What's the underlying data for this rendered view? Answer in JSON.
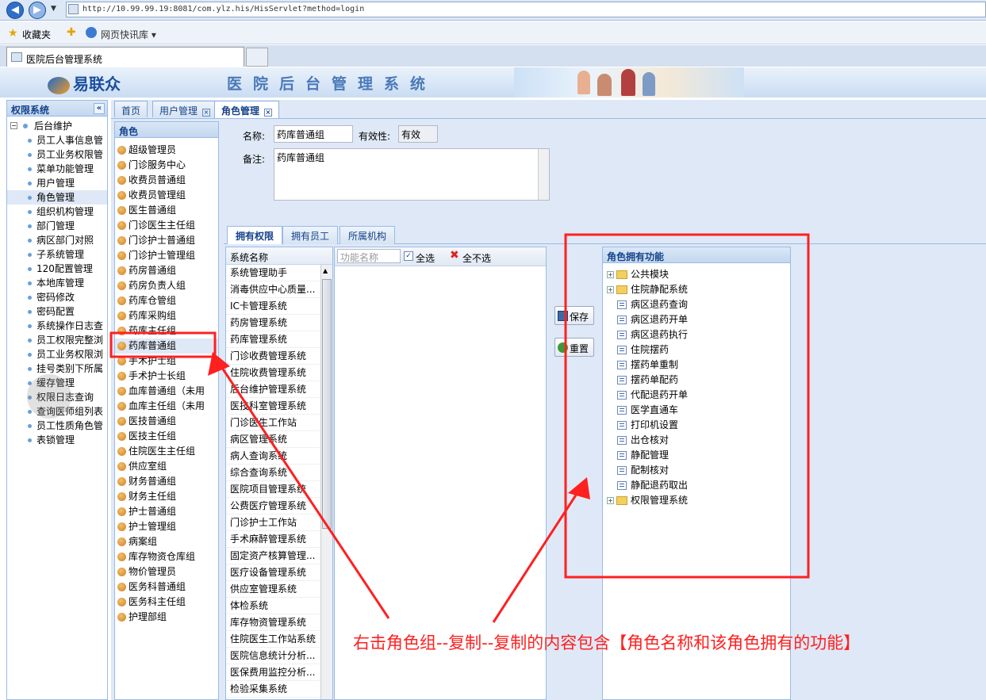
{
  "browser": {
    "url": "http://10.99.99.19:8081/com.ylz.his/HisServlet?method=login",
    "favorites_label": "收藏夹",
    "quick_link_label": "网页快讯库",
    "tab_title": "医院后台管理系统"
  },
  "header": {
    "logo_text": "易联众",
    "system_title": "医院后台管理系统"
  },
  "left_nav": {
    "title": "权限系统",
    "root": "后台维护",
    "items": [
      "员工人事信息管",
      "员工业务权限管",
      "菜单功能管理",
      "用户管理",
      "角色管理",
      "组织机构管理",
      "部门管理",
      "病区部门对照",
      "子系统管理",
      "120配置管理",
      "本地库管理",
      "密码修改",
      "密码配置",
      "系统操作日志查",
      "员工权限完整浏",
      "员工业务权限浏",
      "挂号类别下所属",
      "缓存管理",
      "权限日志查询",
      "查询医师组列表",
      "员工性质角色管",
      "表锁管理"
    ]
  },
  "tabs": [
    "首页",
    "用户管理",
    "角色管理"
  ],
  "role_panel": {
    "title": "角色",
    "roles": [
      "超级管理员",
      "门诊服务中心",
      "收费员普通组",
      "收费员管理组",
      "医生普通组",
      "门诊医生主任组",
      "门诊护士普通组",
      "门诊护士管理组",
      "药房普通组",
      "药房负责人组",
      "药库仓管组",
      "药库采购组",
      "药库主任组",
      "药库普通组",
      "手术护士组",
      "手术护士长组",
      "血库普通组（未用",
      "血库主任组（未用",
      "医技普通组",
      "医技主任组",
      "住院医生主任组",
      "供应室组",
      "财务普通组",
      "财务主任组",
      "护士普通组",
      "护士管理组",
      "病案组",
      "库存物资仓库组",
      "物价管理员",
      "医务科普通组",
      "医务科主任组",
      "护理部组"
    ]
  },
  "form": {
    "name_label": "名称:",
    "name_value": "药库普通组",
    "validity_label": "有效性:",
    "validity_value": "有效",
    "remark_label": "备注:",
    "remark_value": "药库普通组"
  },
  "sub_tabs": [
    "拥有权限",
    "拥有员工",
    "所属机构"
  ],
  "system_list": {
    "header": "系统名称",
    "items": [
      "系统管理助手",
      "消毒供应中心质量...",
      "IC卡管理系统",
      "药房管理系统",
      "药库管理系统",
      "门诊收费管理系统",
      "住院收费管理系统",
      "后台维护管理系统",
      "医技科室管理系统",
      "门诊医生工作站",
      "病区管理系统",
      "病人查询系统",
      "综合查询系统",
      "医院项目管理系统",
      "公费医疗管理系统",
      "门诊护士工作站",
      "手术麻醉管理系统",
      "固定资产核算管理...",
      "医疗设备管理系统",
      "供应室管理系统",
      "体检系统",
      "库存物资管理系统",
      "住院医生工作站系统",
      "医院信息统计分析...",
      "医保费用监控分析...",
      "检验采集系统"
    ]
  },
  "function_toolbar": {
    "search_placeholder": "功能名称",
    "select_all": "全选",
    "deselect_all": "全不选"
  },
  "buttons": {
    "save": "保存",
    "reset": "重置"
  },
  "role_functions": {
    "title": "角色拥有功能",
    "nodes": [
      {
        "label": "公共模块",
        "type": "folder"
      },
      {
        "label": "住院静配系统",
        "type": "folder"
      },
      {
        "label": "病区退药查询",
        "type": "leaf"
      },
      {
        "label": "病区退药开单",
        "type": "leaf"
      },
      {
        "label": "病区退药执行",
        "type": "leaf"
      },
      {
        "label": "住院摆药",
        "type": "leaf"
      },
      {
        "label": "摆药单重制",
        "type": "leaf"
      },
      {
        "label": "摆药单配药",
        "type": "leaf"
      },
      {
        "label": "代配退药开单",
        "type": "leaf"
      },
      {
        "label": "医学直通车",
        "type": "leaf"
      },
      {
        "label": "打印机设置",
        "type": "leaf"
      },
      {
        "label": "出仓核对",
        "type": "leaf"
      },
      {
        "label": "静配管理",
        "type": "leaf"
      },
      {
        "label": "配制核对",
        "type": "leaf"
      },
      {
        "label": "静配退药取出",
        "type": "leaf"
      },
      {
        "label": "权限管理系统",
        "type": "folder"
      }
    ]
  },
  "annotation": {
    "text": "右击角色组--复制--复制的内容包含【角色名称和该角色拥有的功能】",
    "color": "#ff2020"
  }
}
